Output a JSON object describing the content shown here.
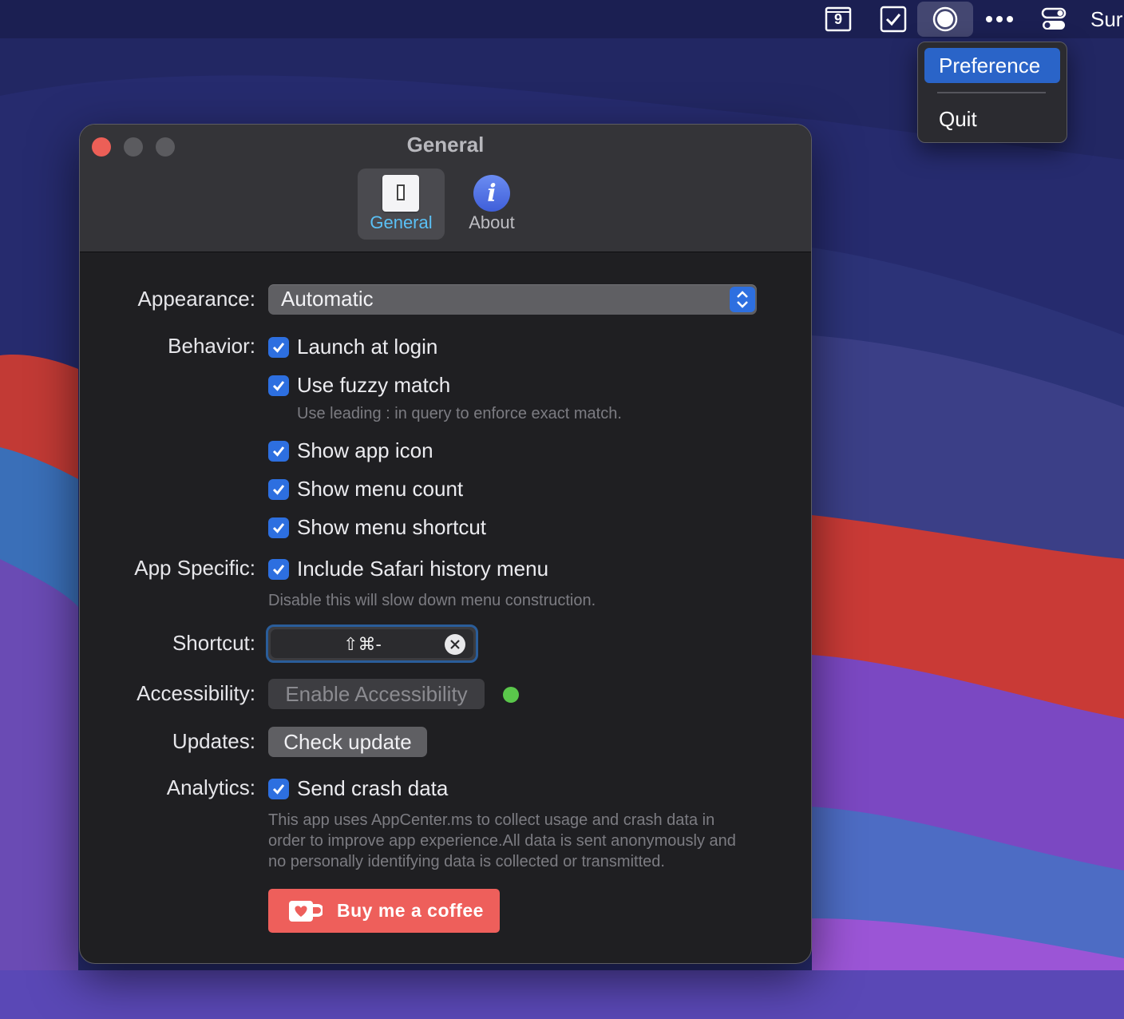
{
  "menubar": {
    "calendar_day": "9",
    "partial_text": "Sur",
    "icons": [
      "calendar-icon",
      "checkbox-icon",
      "app-circle-icon",
      "more-dots-icon",
      "control-center-icon"
    ]
  },
  "dropdown": {
    "items": [
      {
        "label": "Preference",
        "selected": true
      },
      {
        "label": "Quit",
        "selected": false
      }
    ]
  },
  "window": {
    "title": "General",
    "tabs": [
      {
        "label": "General",
        "icon": "switch-icon",
        "active": true
      },
      {
        "label": "About",
        "icon": "info-icon",
        "active": false
      }
    ]
  },
  "form": {
    "appearance": {
      "label": "Appearance:",
      "value": "Automatic"
    },
    "behavior": {
      "label": "Behavior:",
      "options": [
        {
          "text": "Launch at login",
          "checked": true
        },
        {
          "text": "Use fuzzy match",
          "checked": true
        },
        {
          "text": "Show app icon",
          "checked": true
        },
        {
          "text": "Show menu count",
          "checked": true
        },
        {
          "text": "Show menu shortcut",
          "checked": true
        }
      ],
      "fuzzy_hint": "Use leading : in query to enforce exact match."
    },
    "app_specific": {
      "label": "App Specific:",
      "option": {
        "text": "Include Safari history menu",
        "checked": true
      },
      "hint": "Disable this will slow down menu construction."
    },
    "shortcut": {
      "label": "Shortcut:",
      "value": "⇧⌘-"
    },
    "accessibility": {
      "label": "Accessibility:",
      "button": "Enable Accessibility",
      "status_color": "#5ac74b"
    },
    "updates": {
      "label": "Updates:",
      "button": "Check update"
    },
    "analytics": {
      "label": "Analytics:",
      "option": {
        "text": "Send crash data",
        "checked": true
      },
      "hint_lines": [
        "This app uses AppCenter.ms to collect usage and crash data in",
        "order to improve app experience.All data is sent anonymously and",
        "no personally identifying data is collected or transmitted."
      ]
    },
    "coffee_button": "Buy me a coffee"
  },
  "colors": {
    "accent": "#2d6fe0",
    "coffee": "#ee5f5b",
    "close": "#ec5f57"
  }
}
